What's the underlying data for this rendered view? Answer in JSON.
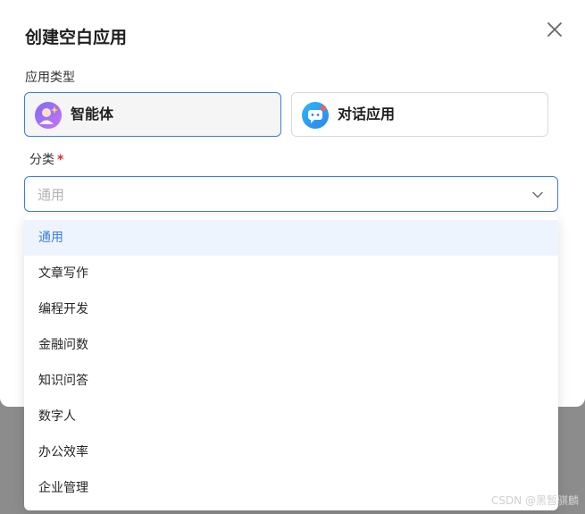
{
  "dialog": {
    "title": "创建空白应用",
    "close_icon": "close-icon"
  },
  "app_type": {
    "label": "应用类型",
    "options": [
      {
        "label": "智能体",
        "icon": "agent-icon",
        "selected": true
      },
      {
        "label": "对话应用",
        "icon": "chat-app-icon",
        "selected": false
      }
    ]
  },
  "category": {
    "label": "分类",
    "required_mark": "*",
    "value": "通用",
    "chevron_icon": "chevron-down-icon",
    "options": [
      "通用",
      "文章写作",
      "编程开发",
      "金融问数",
      "知识问答",
      "数字人",
      "办公效率",
      "企业管理"
    ],
    "highlighted_index": 0
  },
  "watermark": "CSDN @黑暂骐麟",
  "colors": {
    "accent": "#3b7ddd",
    "required": "#e0282e",
    "highlight_bg": "#eef4fd",
    "overlay": "#8c8c8c"
  }
}
